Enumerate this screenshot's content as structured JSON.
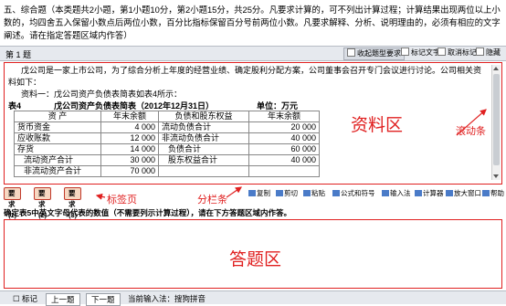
{
  "question_header": "五、综合题（本类题共2小题，第1小题10分，第2小题15分，共25分。凡要求计算的，可不列出计算过程；计算结果出现两位以上小数的，均四舍五入保留小数点后两位小数，百分比指标保留百分号前两位小数。凡要求解释、分析、说明理由的，必须有相应的文字阐述。请在指定答题区域内作答）",
  "toolbar": {
    "question_no": "第 1 题",
    "collapse_label": "收起题型要求",
    "mark_label": "标记文字",
    "cancel_mark_label": "取消标记",
    "hide_label": "隐藏"
  },
  "material": {
    "para1": "戊公司是一家上市公司，为了综合分析上年度的经营业绩、确定股利分配方案，公司董事会召开专门会议进行讨论。公司相关资料如下：",
    "para2": "资料一：戊公司资产负债表简表如表4所示：",
    "table_no": "表4",
    "table_title": "戊公司资产负债表简表（2012年12月31日）",
    "table_unit": "单位：万元",
    "headers": [
      "资 产",
      "年末余额",
      "负债和股东权益",
      "年末余额"
    ],
    "rows": [
      [
        "货币资金",
        "4 000",
        "流动负债合计",
        "20 000"
      ],
      [
        "应收账款",
        "12 000",
        "非流动负债合计",
        "40 000"
      ],
      [
        "存货",
        "14 000",
        "负债合计",
        "60 000"
      ],
      [
        "流动资产合计",
        "30 000",
        "股东权益合计",
        "40 000"
      ],
      [
        "非流动资产合计",
        "70 000",
        "",
        ""
      ]
    ]
  },
  "annotations": {
    "material_area": "资料区",
    "scrollbar": "滚动条",
    "tab_page": "标签页",
    "split_bar": "分栏条",
    "answer_area": "答题区"
  },
  "tabs": [
    "要求(1)",
    "要求(2)",
    "要求(3)"
  ],
  "tools": [
    "复制",
    "剪切",
    "粘贴",
    "公式和符号",
    "输入法",
    "计算器",
    "放大窗口",
    "帮助"
  ],
  "instruction": "确定表5中英文字母代表的数值（不需要列示计算过程），请在下方答题区域内作答。",
  "bottombar": {
    "mark": "标记",
    "prev": "上一题",
    "next": "下一题",
    "ime_status": "当前输入法：搜狗拼音"
  },
  "colors": {
    "annotation_red": "#e02020",
    "toolbar_bg": "#e6e9ee",
    "tab_bg": "#f7d8c2"
  }
}
